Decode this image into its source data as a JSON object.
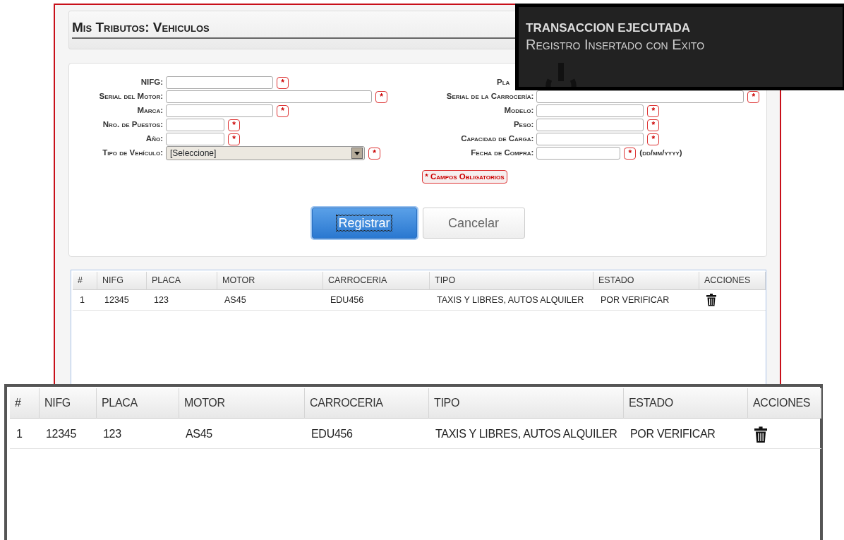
{
  "page_title": "Mis Tributos: Vehiculos",
  "form": {
    "required_mark": "*",
    "left_fields": [
      {
        "label": "NIFG:",
        "kind": "text",
        "required": true
      },
      {
        "label": "Serial del Motor:",
        "kind": "text",
        "required": true
      },
      {
        "label": "Marca:",
        "kind": "text",
        "required": true
      },
      {
        "label": "Nro. de Puestos:",
        "kind": "text",
        "required": true
      },
      {
        "label": "Año:",
        "kind": "text",
        "required": true
      },
      {
        "label": "Tipo de Vehículo:",
        "kind": "select",
        "value": "[Seleccione]",
        "required": true
      }
    ],
    "right_fields": [
      {
        "label": "Pla",
        "kind": "hidden"
      },
      {
        "label": "Serial de la Carrocería:",
        "kind": "text",
        "required": true
      },
      {
        "label": "Modelo:",
        "kind": "text",
        "required": true
      },
      {
        "label": "Peso:",
        "kind": "text",
        "required": true
      },
      {
        "label": "Capacidad de Carga:",
        "kind": "text",
        "required": true
      },
      {
        "label": "Fecha de Compra:",
        "kind": "text",
        "required": true,
        "hint": "(dd/mm/yyyy)"
      }
    ],
    "required_note": "* Campos Obligatorios"
  },
  "buttons": [
    {
      "label": "Registrar",
      "kind": "primary",
      "focused": true
    },
    {
      "label": "Cancelar",
      "kind": "secondary",
      "focused": false
    }
  ],
  "table": {
    "columns": [
      "#",
      "NIFG",
      "PLACA",
      "MOTOR",
      "CARROCERIA",
      "TIPO",
      "ESTADO",
      "ACCIONES"
    ],
    "rows": [
      {
        "cells": [
          "1",
          "12345",
          "123",
          "AS45",
          "EDU456",
          "TAXIS Y LIBRES, AUTOS ALQUILER",
          "POR VERIFICAR"
        ]
      }
    ]
  },
  "toast": {
    "title": "TRANSACCION EJECUTADA",
    "message": "Registro Insertado con Exito"
  },
  "zoom_callout": {
    "columns": [
      "#",
      "NIFG",
      "PLACA",
      "MOTOR",
      "CARROCERIA",
      "TIPO",
      "ESTADO",
      "ACCIONES"
    ],
    "rows": [
      {
        "cells": [
          "1",
          "12345",
          "123",
          "AS45",
          "EDU456",
          "TAXIS Y LIBRES, AUTOS ALQUILER",
          "POR VERIFICAR"
        ]
      }
    ]
  }
}
